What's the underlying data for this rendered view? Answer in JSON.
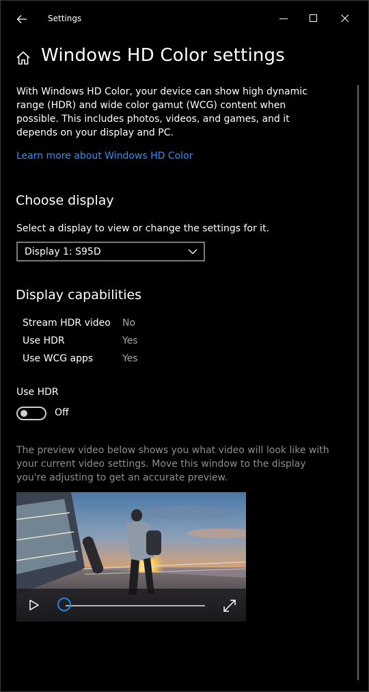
{
  "window": {
    "title": "Settings"
  },
  "header": {
    "title": "Windows HD Color settings"
  },
  "intro": {
    "description": "With Windows HD Color, your device can show high dynamic range (HDR) and wide color gamut (WCG) content when possible. This includes photos, videos, and games, and it depends on your display and PC.",
    "learn_more": "Learn more about Windows HD Color"
  },
  "choose_display": {
    "title": "Choose display",
    "label": "Select a display to view or change the settings for it.",
    "selected": "Display 1: S95D"
  },
  "capabilities": {
    "title": "Display capabilities",
    "rows": [
      {
        "label": "Stream HDR video",
        "value": "No"
      },
      {
        "label": "Use HDR",
        "value": "Yes"
      },
      {
        "label": "Use WCG apps",
        "value": "Yes"
      }
    ]
  },
  "hdr_toggle": {
    "label": "Use HDR",
    "state": "Off",
    "on": false
  },
  "preview": {
    "note": "The preview video below shows you what video will look like with your current video settings. Move this window to the display you're adjusting to get an accurate preview.",
    "progress": 0
  },
  "icons": {
    "back": "arrow-left-icon",
    "home": "home-icon",
    "minimize": "minimize-icon",
    "maximize": "maximize-icon",
    "close": "close-icon",
    "dropdown": "chevron-down-icon",
    "play": "play-icon",
    "fullscreen": "fullscreen-icon"
  },
  "colors": {
    "accent": "#3b8eea",
    "seek_accent": "#1e88e5",
    "background": "#000000"
  }
}
